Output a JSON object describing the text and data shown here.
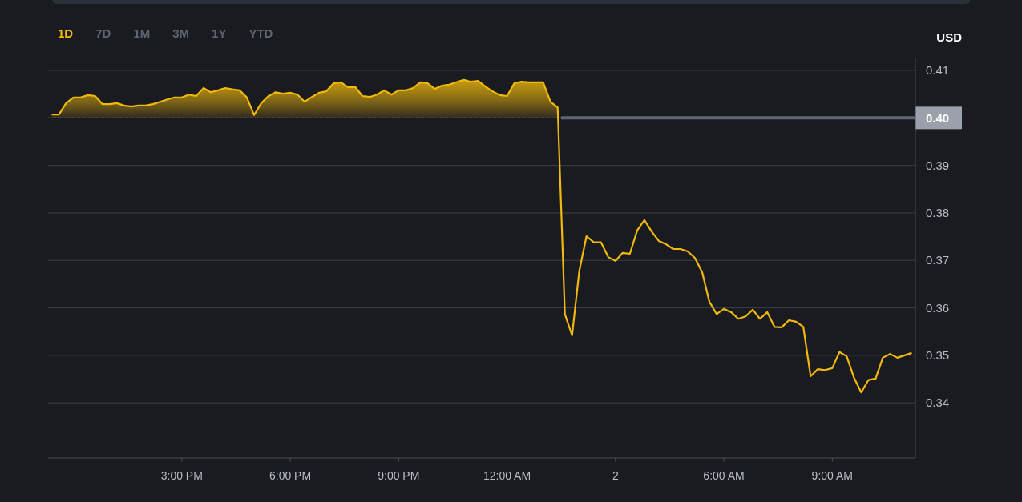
{
  "range_tabs": [
    {
      "label": "1D",
      "selected": true
    },
    {
      "label": "7D",
      "selected": false
    },
    {
      "label": "1M",
      "selected": false
    },
    {
      "label": "3M",
      "selected": false
    },
    {
      "label": "1Y",
      "selected": false
    },
    {
      "label": "YTD",
      "selected": false
    }
  ],
  "currency": "USD",
  "chart_data": {
    "type": "line",
    "categories": [
      null,
      null,
      null,
      null,
      null,
      null,
      null,
      null,
      null,
      null,
      null,
      null,
      null,
      null,
      null,
      null,
      null,
      null,
      "3:00 PM",
      null,
      null,
      null,
      null,
      null,
      null,
      null,
      null,
      null,
      null,
      null,
      null,
      null,
      null,
      "6:00 PM",
      null,
      null,
      null,
      null,
      null,
      null,
      null,
      null,
      null,
      null,
      null,
      null,
      null,
      null,
      "9:00 PM",
      null,
      null,
      null,
      null,
      null,
      null,
      null,
      null,
      null,
      null,
      null,
      null,
      null,
      null,
      "12:00 AM",
      null,
      null,
      null,
      null,
      null,
      null,
      null,
      null,
      null,
      null,
      null,
      null,
      null,
      null,
      "2",
      null,
      null,
      null,
      null,
      null,
      null,
      null,
      null,
      null,
      null,
      null,
      null,
      null,
      null,
      "6:00 AM",
      null,
      null,
      null,
      null,
      null,
      null,
      null,
      null,
      null,
      null,
      null,
      null,
      null,
      null,
      "9:00 AM",
      null,
      null,
      null,
      null,
      null,
      null,
      null,
      null,
      null,
      null,
      null
    ],
    "series": [
      {
        "color": "#f0b90b",
        "values": [
          0.4007,
          0.4007,
          0.4031,
          0.4043,
          0.4043,
          0.4048,
          0.4046,
          0.4029,
          0.4029,
          0.4031,
          0.4026,
          0.4024,
          0.4026,
          0.4026,
          0.4029,
          0.4034,
          0.4039,
          0.4043,
          0.4043,
          0.4049,
          0.4046,
          0.4063,
          0.4054,
          0.4058,
          0.4063,
          0.406,
          0.4058,
          0.4043,
          0.4006,
          0.4031,
          0.4046,
          0.4054,
          0.4051,
          0.4053,
          0.4049,
          0.4034,
          0.4044,
          0.4053,
          0.4056,
          0.4073,
          0.4075,
          0.4065,
          0.4065,
          0.4046,
          0.4044,
          0.4049,
          0.4058,
          0.4049,
          0.4058,
          0.4058,
          0.4063,
          0.4075,
          0.4073,
          0.4061,
          0.4068,
          0.407,
          0.4075,
          0.408,
          0.4076,
          0.4078,
          0.4066,
          0.4056,
          0.4048,
          0.4046,
          0.4073,
          0.4076,
          0.4075,
          0.4075,
          0.4075,
          0.4034,
          0.4022,
          0.3587,
          0.3542,
          0.3678,
          0.3751,
          0.3738,
          0.3738,
          0.3707,
          0.3699,
          0.3716,
          0.3714,
          0.3763,
          0.3785,
          0.3761,
          0.3741,
          0.3734,
          0.3724,
          0.3724,
          0.3719,
          0.3705,
          0.3675,
          0.3613,
          0.3587,
          0.3598,
          0.3591,
          0.3577,
          0.3582,
          0.3596,
          0.3577,
          0.3591,
          0.356,
          0.3559,
          0.3574,
          0.3571,
          0.356,
          0.3456,
          0.3471,
          0.3469,
          0.3473,
          0.3507,
          0.3498,
          0.3453,
          0.3422,
          0.3448,
          0.3451,
          0.3495,
          0.3503,
          0.3495,
          0.35,
          0.3505
        ]
      }
    ],
    "ylim": [
      0.3284,
      0.4127
    ],
    "grid": true,
    "yticks": [
      0.34,
      0.35,
      0.36,
      0.37,
      0.38,
      0.39,
      {
        "value": 0.4,
        "label": "0.40"
      },
      0.41
    ],
    "ref_lines": [
      {
        "axis": "y",
        "value": 0.4
      },
      {
        "axis": "y",
        "value": 0.4
      }
    ]
  }
}
